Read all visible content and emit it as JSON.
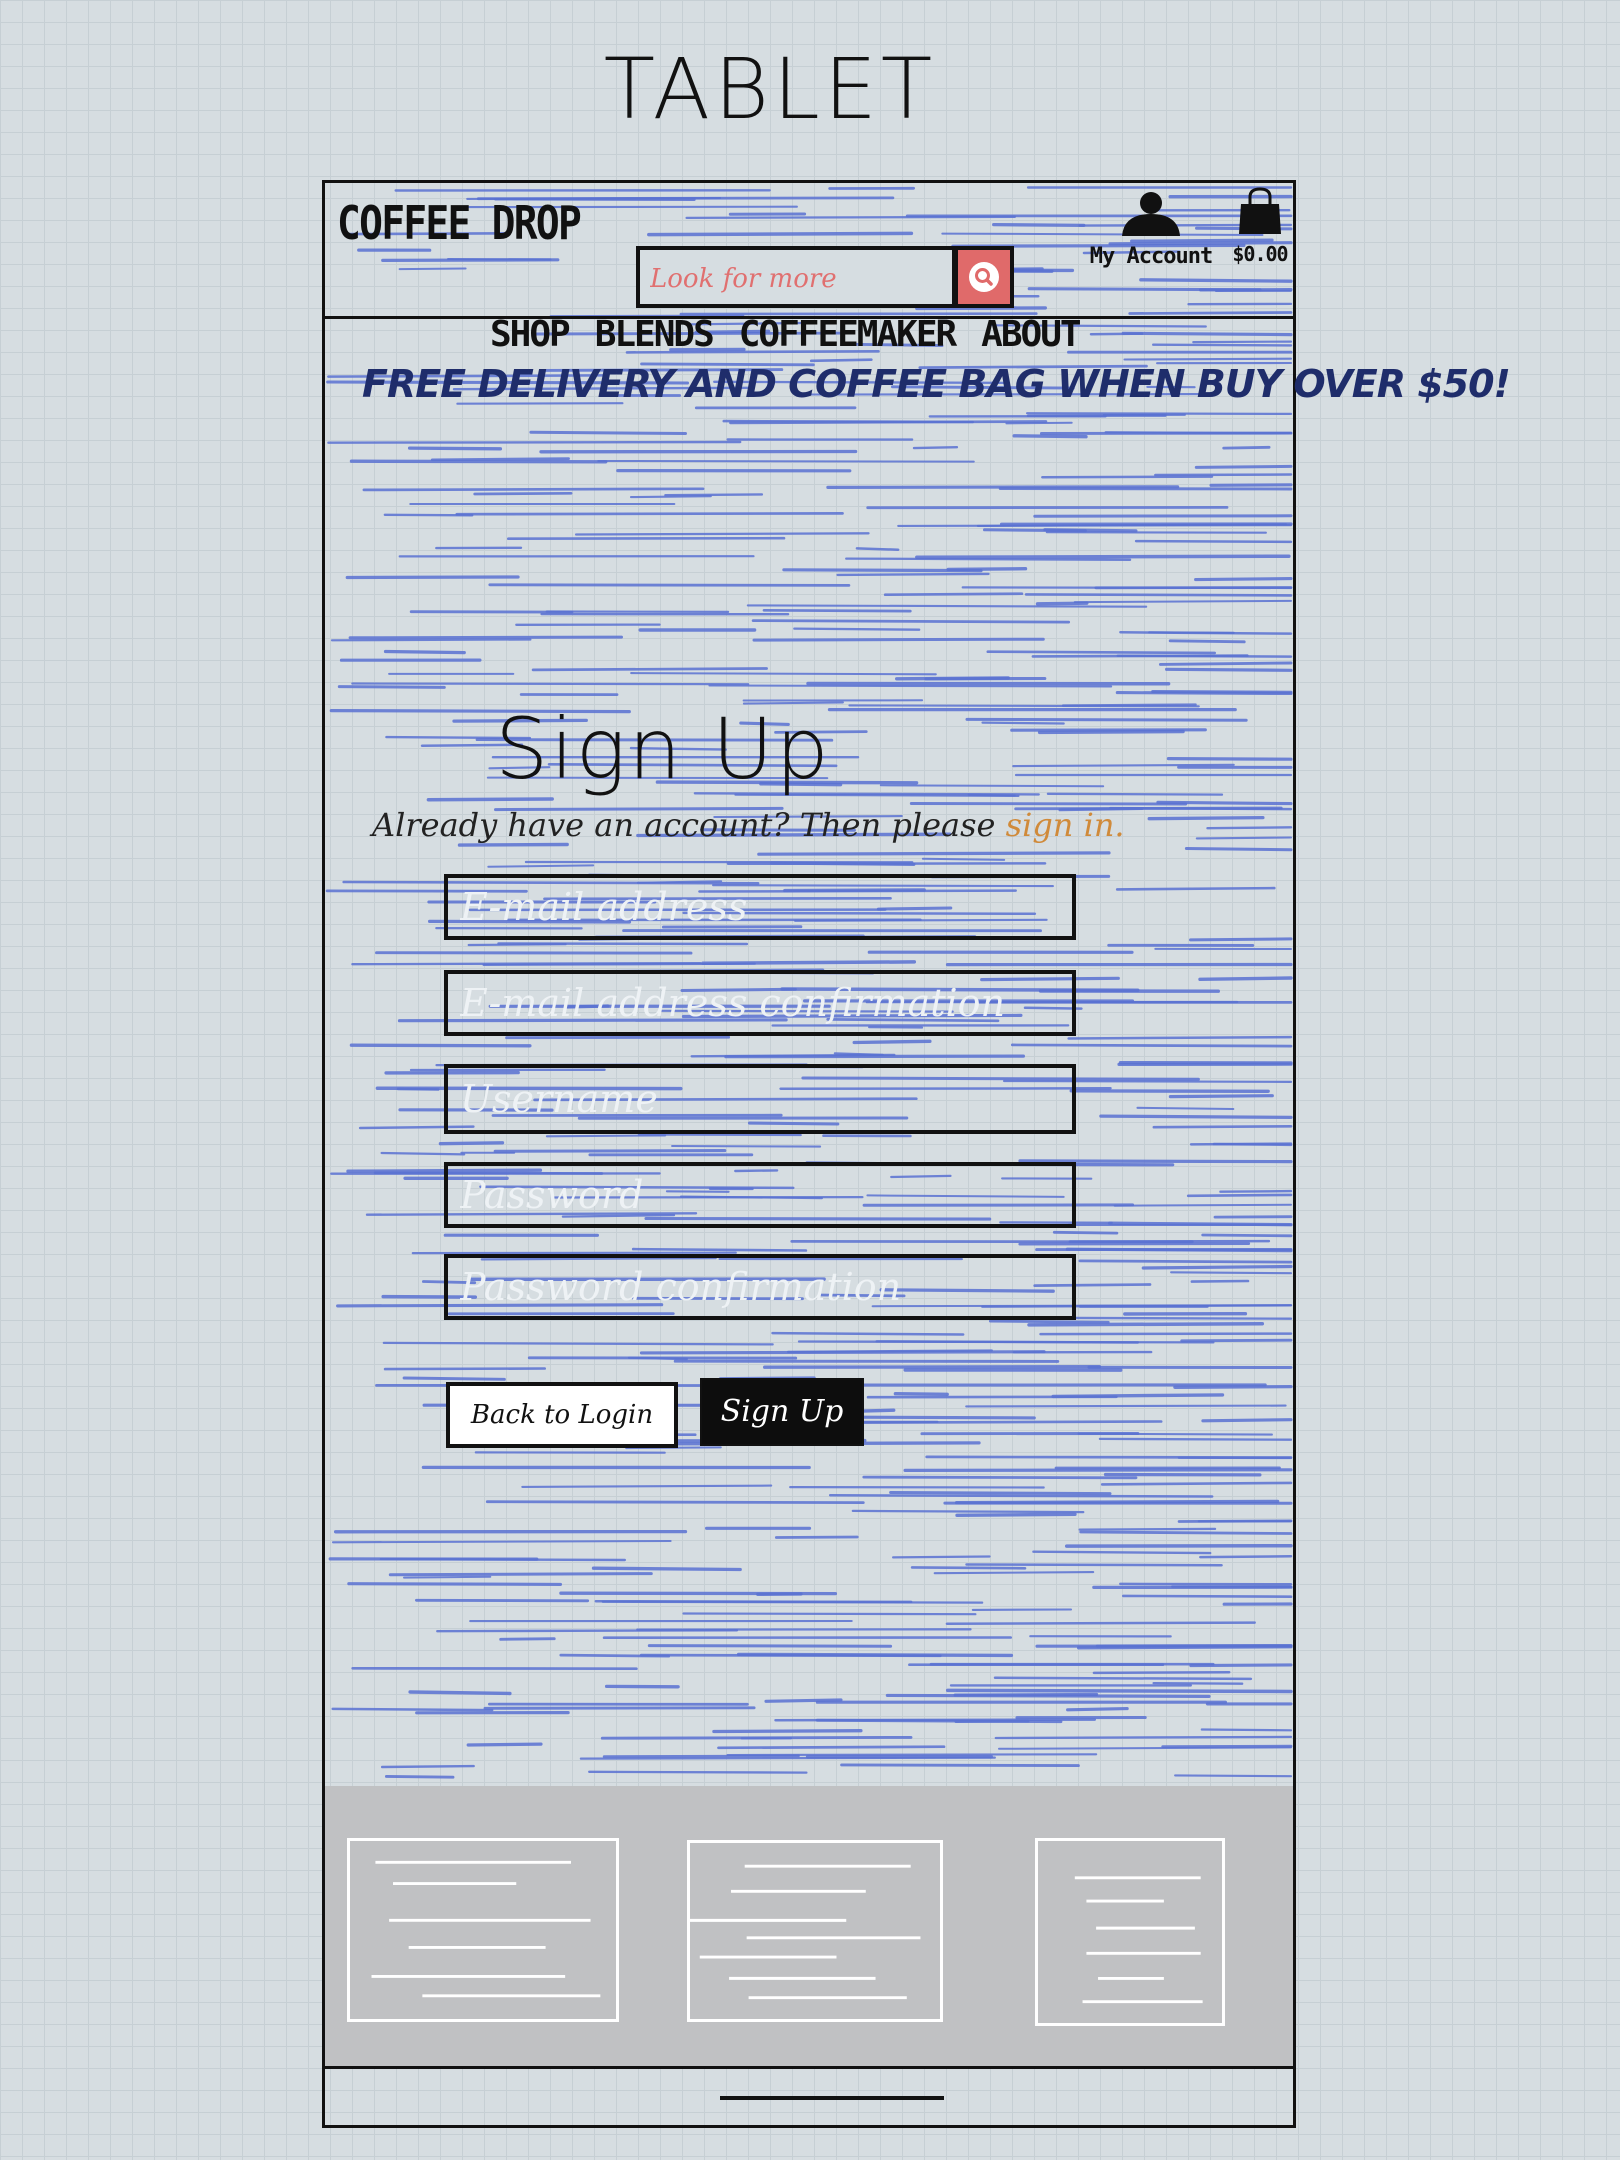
{
  "title": "TABLET",
  "header": {
    "logo": "COFFEE DROP",
    "search_placeholder": "Look for more",
    "account_label": "My Account",
    "cart_total": "$0.00"
  },
  "nav": {
    "items": [
      {
        "label": "SHOP"
      },
      {
        "label": "BLENDS"
      },
      {
        "label": "COFFEEMAKER"
      },
      {
        "label": "ABOUT"
      }
    ]
  },
  "promo": "FREE DELIVERY AND COFFEE BAG WHEN BUY OVER $50!",
  "form": {
    "heading": "Sign Up",
    "signin_prompt": "Already have an account? Then please ",
    "signin_link": "sign in.",
    "fields": [
      {
        "placeholder": "E-mail address"
      },
      {
        "placeholder": "E-mail address confirmation"
      },
      {
        "placeholder": "Username"
      },
      {
        "placeholder": "Password"
      },
      {
        "placeholder": "Password confirmation"
      }
    ],
    "back_label": "Back to Login",
    "submit_label": "Sign Up"
  },
  "colors": {
    "hatch": "#5a72d2",
    "promo": "#1f2d6b",
    "search_button": "#e06a6a",
    "link": "#d08a3a",
    "footer": "#c0c1c3"
  }
}
